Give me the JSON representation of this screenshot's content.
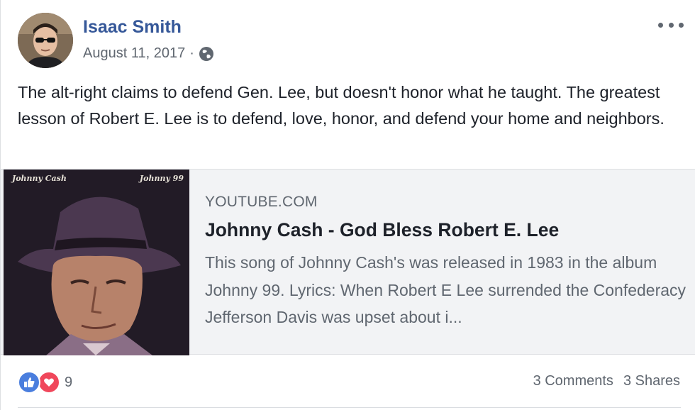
{
  "post": {
    "author_name": "Isaac Smith",
    "date": "August 11, 2017",
    "separator": "·",
    "privacy_icon": "globe-icon",
    "more_icon": "more-options-icon",
    "body": "The alt-right claims to defend Gen. Lee, but doesn't honor what he taught. The greatest lesson of Robert E. Lee is to defend, love, honor, and defend your home and neighbors."
  },
  "link_preview": {
    "thumbnail_text_left": "Johnny Cash",
    "thumbnail_text_right": "Johnny 99",
    "domain": "YOUTUBE.COM",
    "title": "Johnny Cash - God Bless Robert E. Lee",
    "description": "This song of Johnny Cash's was released in 1983 in the album Johnny 99. Lyrics: When Robert E Lee surrended the Confederacy Jefferson Davis was upset about i..."
  },
  "footer": {
    "reaction_icons": [
      "like-icon",
      "love-icon"
    ],
    "reaction_count": "9",
    "comments": "3 Comments",
    "shares": "3 Shares"
  },
  "colors": {
    "author_link": "#365899",
    "secondary_text": "#606770",
    "like_blue": "#4a7ede",
    "love_red": "#f0475b",
    "card_bg": "#f2f3f5"
  }
}
